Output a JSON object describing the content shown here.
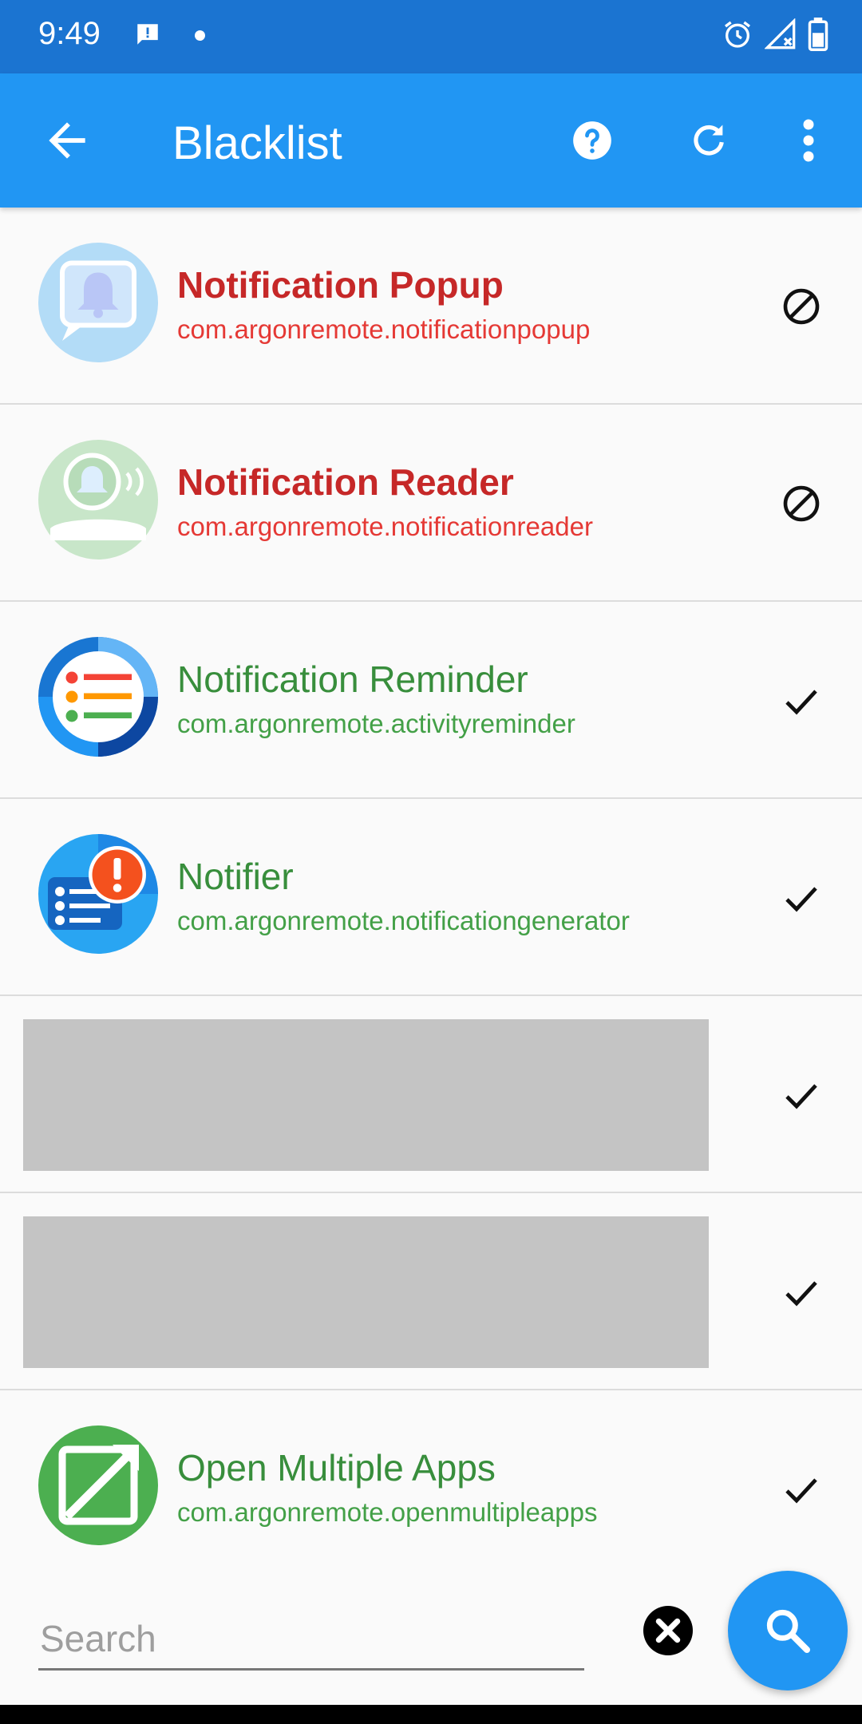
{
  "status_bar": {
    "time": "9:49",
    "icons": [
      "message-alert-icon",
      "dot-icon",
      "alarm-icon",
      "signal-no-data-icon",
      "battery-icon"
    ]
  },
  "app_bar": {
    "title": "Blacklist",
    "icons": [
      "back-arrow-icon",
      "help-icon",
      "refresh-icon",
      "more-vert-icon"
    ],
    "color": "#2196f3"
  },
  "apps": [
    {
      "name": "Notification Popup",
      "package": "com.argonremote.notificationpopup",
      "state": "blocked"
    },
    {
      "name": "Notification Reader",
      "package": "com.argonremote.notificationreader",
      "state": "blocked"
    },
    {
      "name": "Notification Reminder",
      "package": "com.argonremote.activityreminder",
      "state": "allowed"
    },
    {
      "name": "Notifier",
      "package": "com.argonremote.notificationgenerator",
      "state": "allowed"
    },
    {
      "name": "",
      "package": "",
      "state": "allowed",
      "redacted": true
    },
    {
      "name": "",
      "package": "",
      "state": "allowed",
      "redacted": true
    },
    {
      "name": "Open Multiple Apps",
      "package": "com.argonremote.openmultipleapps",
      "state": "allowed"
    }
  ],
  "search": {
    "placeholder": "Search",
    "value": ""
  },
  "colors": {
    "blocked_name": "#c62828",
    "allowed_name": "#388e3c",
    "status_bar": "#1b74d1"
  }
}
